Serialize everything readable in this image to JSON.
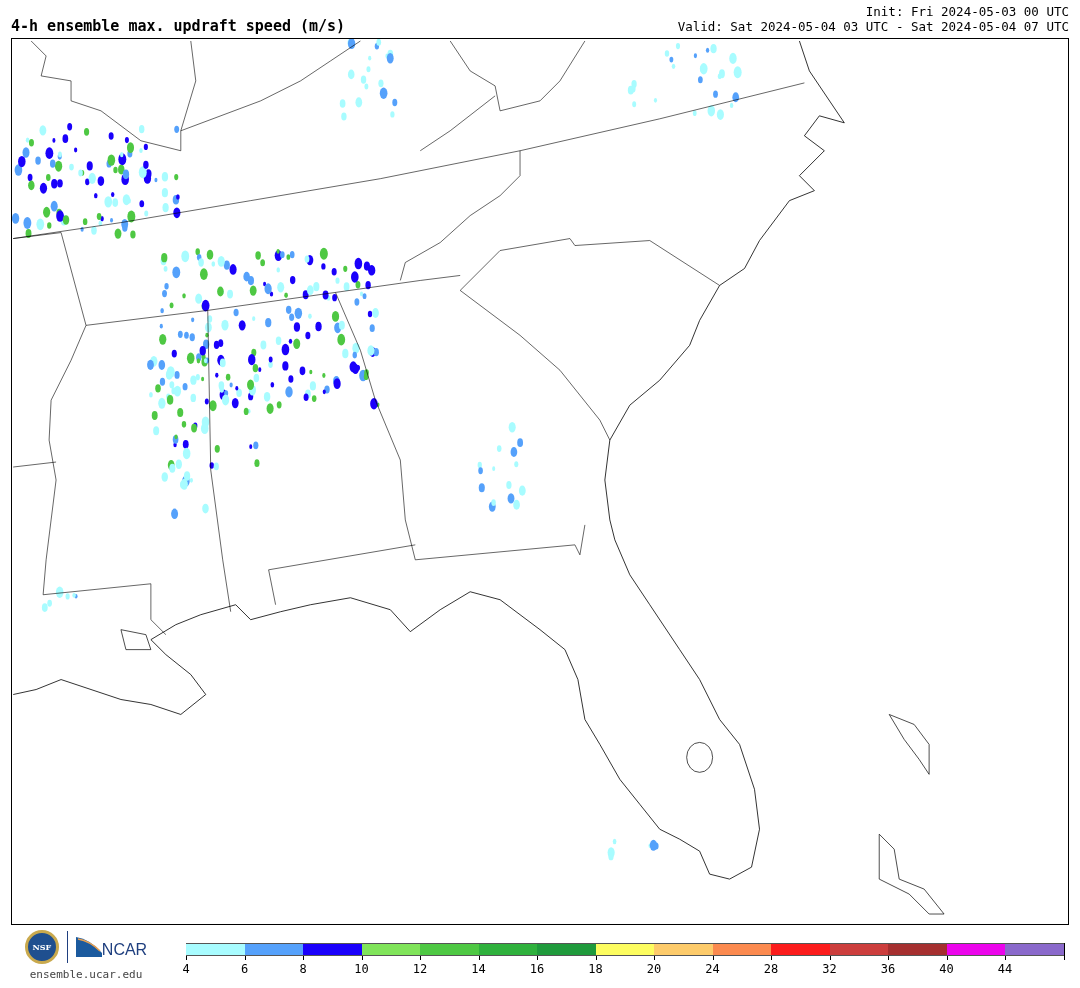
{
  "title": "4-h ensemble max. updraft speed (m/s)",
  "init": "Init: Fri 2024-05-03 00 UTC",
  "valid": "Valid: Sat 2024-05-04 03 UTC - Sat 2024-05-04 07 UTC",
  "logo": {
    "nsf_text": "NSF",
    "ncar_text": "NCAR",
    "url": "ensemble.ucar.edu"
  },
  "colorbar": {
    "bins": [
      {
        "color": "#a8fcff"
      },
      {
        "color": "#55a1fb"
      },
      {
        "color": "#1a00fb"
      },
      {
        "color": "#80e45a"
      },
      {
        "color": "#4ec843"
      },
      {
        "color": "#2fb13d"
      },
      {
        "color": "#1f9a3c"
      },
      {
        "color": "#fdfd60"
      },
      {
        "color": "#fdcb6b"
      },
      {
        "color": "#fb8a4f"
      },
      {
        "color": "#fb1c1c"
      },
      {
        "color": "#cc3e3d"
      },
      {
        "color": "#a52f2f"
      },
      {
        "color": "#eb04eb"
      },
      {
        "color": "#8a69cb"
      }
    ],
    "labels": [
      "4",
      "6",
      "8",
      "10",
      "12",
      "14",
      "16",
      "18",
      "20",
      "24",
      "28",
      "32",
      "36",
      "40",
      "44"
    ]
  }
}
